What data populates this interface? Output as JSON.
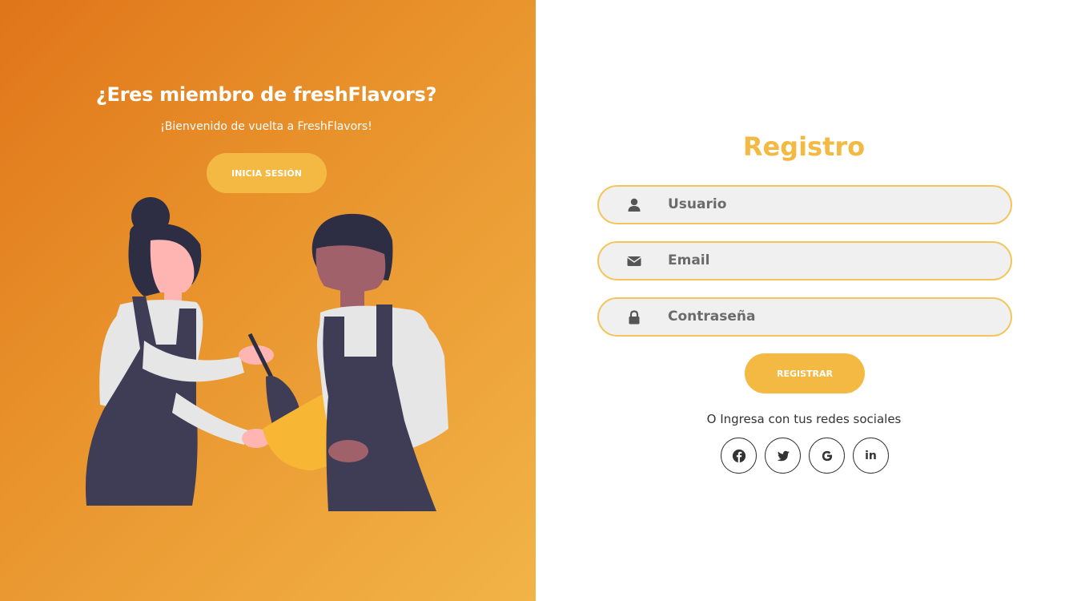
{
  "left": {
    "title": "¿Eres miembro de freshFlavors?",
    "subtitle": "¡Bienvenido de vuelta a FreshFlavors!",
    "login_button": "INICIA SESIÓN"
  },
  "form": {
    "title": "Registro",
    "fields": [
      {
        "placeholder": "Usuario",
        "icon": "user-icon"
      },
      {
        "placeholder": "Email",
        "icon": "envelope-icon"
      },
      {
        "placeholder": "Contraseña",
        "icon": "lock-icon"
      }
    ],
    "register_button": "REGISTRAR",
    "social_text": "O Ingresa con tus redes sociales",
    "social": [
      {
        "icon": "facebook-icon"
      },
      {
        "icon": "twitter-icon"
      },
      {
        "icon": "google-icon"
      },
      {
        "icon": "linkedin-icon",
        "label": "in"
      }
    ]
  },
  "colors": {
    "accent": "#f4b942",
    "gradient_start": "#e07519",
    "gradient_end": "#f2b447",
    "field_bg": "#f0f0f0"
  }
}
